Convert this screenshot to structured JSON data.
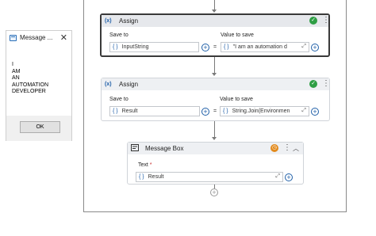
{
  "dialog": {
    "title": "Message ...",
    "close": "✕",
    "message": "I\nAM\nAN\nAUTOMATION\nDEVELOPER",
    "ok_label": "OK"
  },
  "activities": [
    {
      "icon": "(x)",
      "title": "Assign",
      "save_to_label": "Save to",
      "value_label": "Value to save",
      "save_to_value": "InputString",
      "value_text": "\"I am an automation d",
      "equals": "="
    },
    {
      "icon": "(x)",
      "title": "Assign",
      "save_to_label": "Save to",
      "value_label": "Value to save",
      "save_to_value": "Result",
      "value_text": "String.Join(Environmen",
      "equals": "="
    }
  ],
  "message_box": {
    "title": "Message Box",
    "text_label": "Text",
    "required_mark": "*",
    "text_value": "Result"
  },
  "glyphs": {
    "brace": "{ }",
    "plus": "+",
    "more": "⋮",
    "check": "✓",
    "clock": "◷",
    "collapse": "︿",
    "expand": "⤢"
  }
}
